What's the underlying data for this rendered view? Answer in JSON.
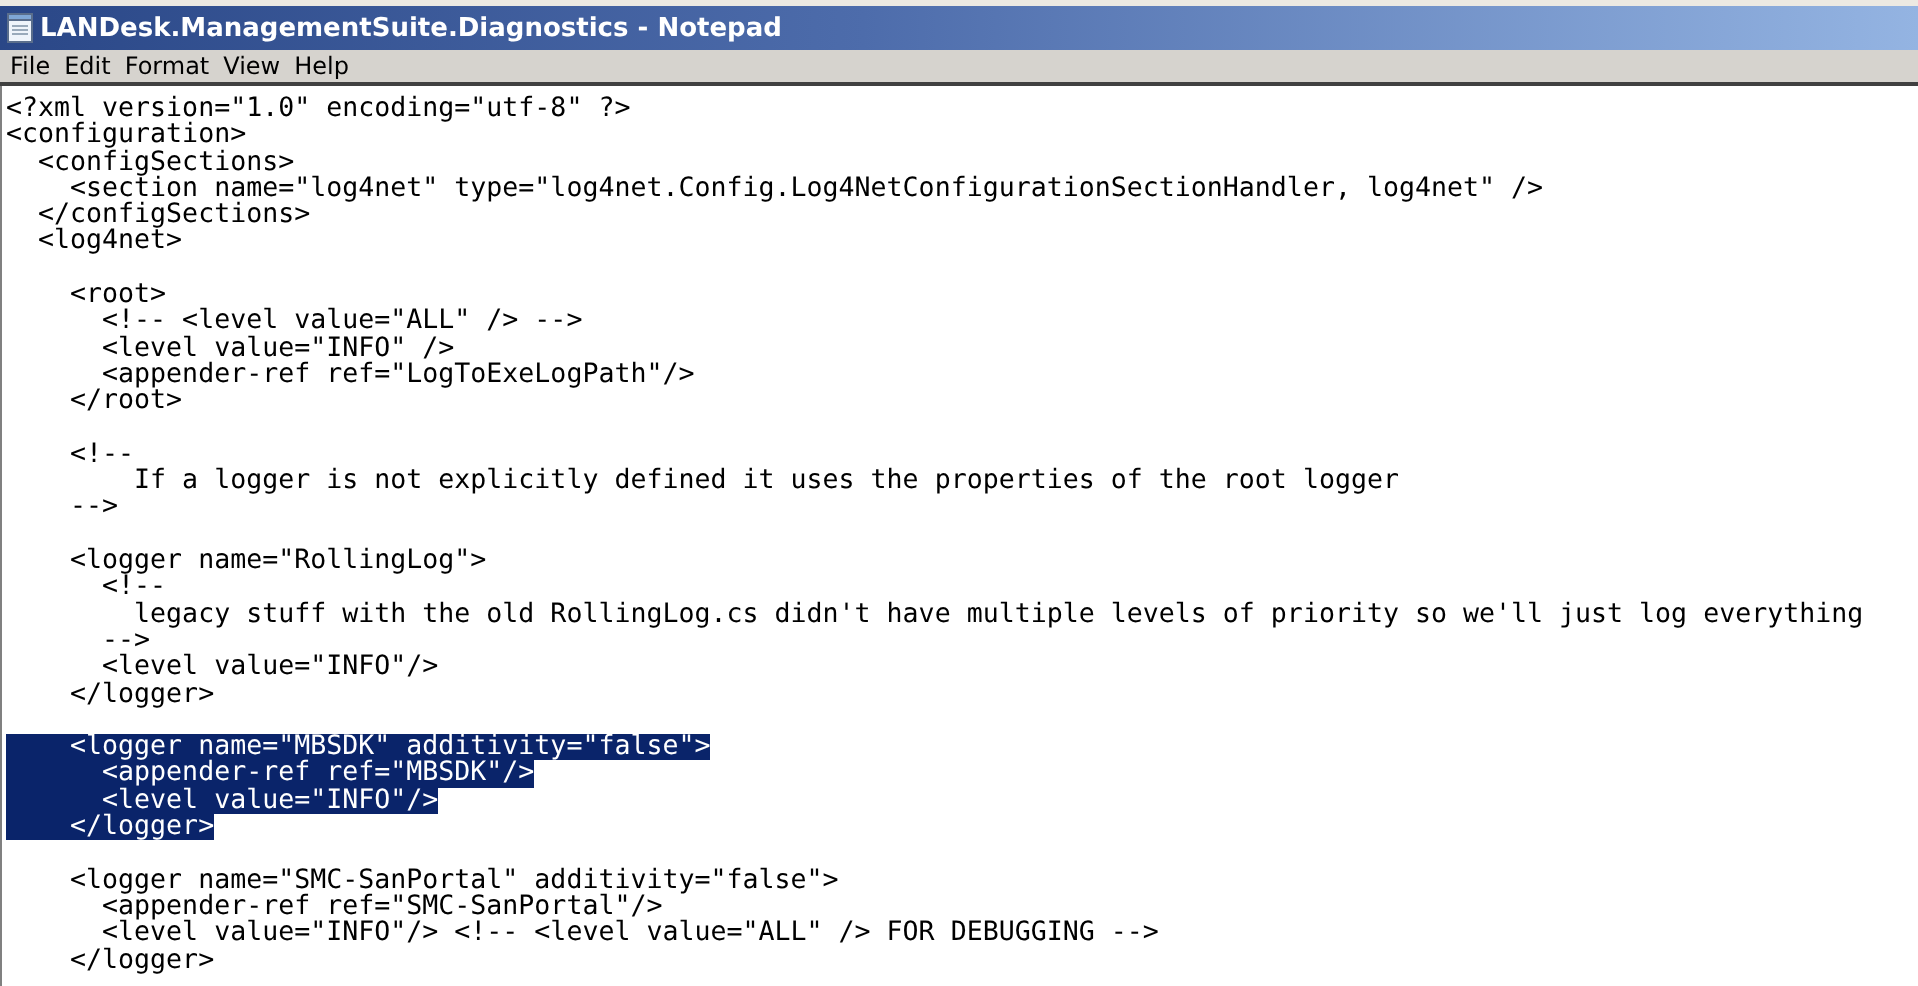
{
  "window": {
    "title": "LANDesk.ManagementSuite.Diagnostics - Notepad"
  },
  "menu": [
    "File",
    "Edit",
    "Format",
    "View",
    "Help"
  ],
  "blocks": [
    {
      "lines": [
        {
          "text": "<?xml version=\"1.0\" encoding=\"utf-8\" ?>",
          "selected": false
        },
        {
          "text": "<configuration>",
          "selected": false
        },
        {
          "text": "  <configSections>",
          "selected": false
        },
        {
          "text": "    <section name=\"log4net\" type=\"log4net.Config.Log4NetConfigurationSectionHandler, log4net\" />",
          "selected": false
        },
        {
          "text": "  </configSections>",
          "selected": false
        },
        {
          "text": "  <log4net>",
          "selected": false
        }
      ]
    },
    {
      "lines": [
        {
          "text": "    <root>",
          "selected": false
        },
        {
          "text": "      <!-- <level value=\"ALL\" /> -->",
          "selected": false
        },
        {
          "text": "      <level value=\"INFO\" />",
          "selected": false
        },
        {
          "text": "      <appender-ref ref=\"LogToExeLogPath\"/>",
          "selected": false
        },
        {
          "text": "    </root>",
          "selected": false
        }
      ]
    },
    {
      "lines": [
        {
          "text": "    <!--",
          "selected": false
        },
        {
          "text": "        If a logger is not explicitly defined it uses the properties of the root logger",
          "selected": false
        },
        {
          "text": "    -->",
          "selected": false
        }
      ]
    },
    {
      "lines": [
        {
          "text": "    <logger name=\"RollingLog\">",
          "selected": false
        },
        {
          "text": "      <!--",
          "selected": false
        },
        {
          "text": "        legacy stuff with the old RollingLog.cs didn't have multiple levels of priority so we'll just log everything",
          "selected": false
        },
        {
          "text": "      -->",
          "selected": false
        },
        {
          "text": "      <level value=\"INFO\"/>",
          "selected": false
        },
        {
          "text": "    </logger>",
          "selected": false
        }
      ]
    },
    {
      "lines": [
        {
          "text": "    <logger name=\"MBSDK\" additivity=\"false\">",
          "selected": true
        },
        {
          "text": "      <appender-ref ref=\"MBSDK\"/>",
          "selected": true
        },
        {
          "text": "      <level value=\"INFO\"/>",
          "selected": true
        },
        {
          "text": "    </logger>",
          "selected": true
        }
      ]
    },
    {
      "lines": [
        {
          "text": "    <logger name=\"SMC-SanPortal\" additivity=\"false\">",
          "selected": false
        },
        {
          "text": "      <appender-ref ref=\"SMC-SanPortal\"/>",
          "selected": false
        },
        {
          "text": "      <level value=\"INFO\"/> <!-- <level value=\"ALL\" /> FOR DEBUGGING -->",
          "selected": false
        },
        {
          "text": "    </logger>",
          "selected": false
        }
      ]
    }
  ]
}
